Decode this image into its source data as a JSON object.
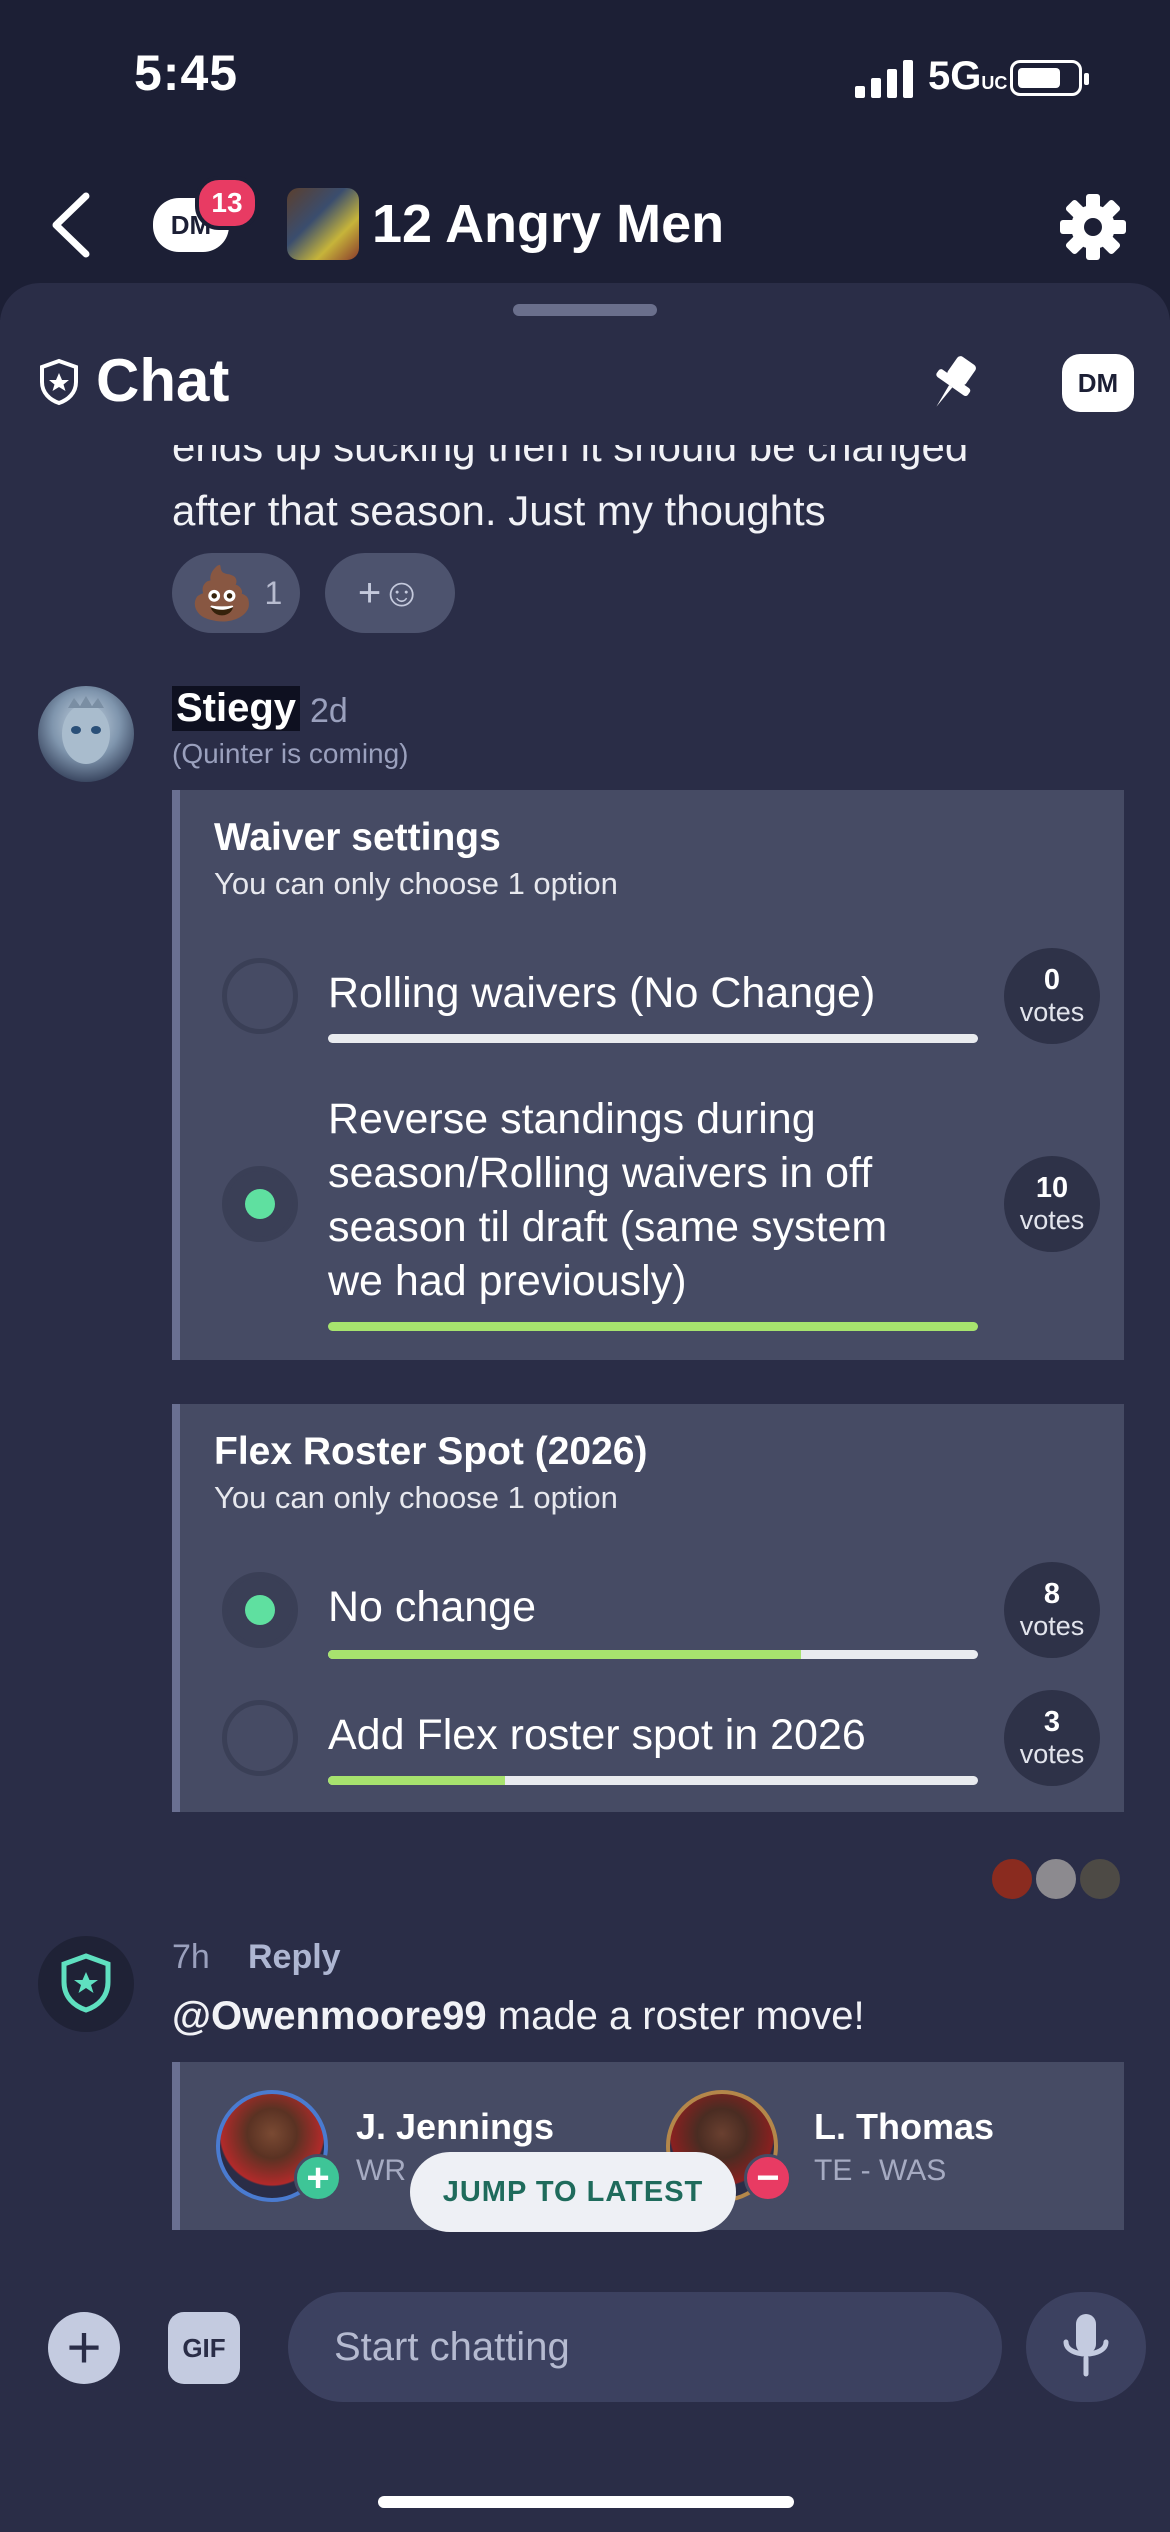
{
  "status_bar": {
    "time": "5:45",
    "network": "5G",
    "network_sup": "UC"
  },
  "header": {
    "dm_label": "DM",
    "dm_count": "13",
    "group_name": "12 Angry Men",
    "icons": [
      "back-chevron-icon",
      "dm-bubble-icon",
      "gear-icon"
    ]
  },
  "chat_header": {
    "title": "Chat",
    "dm_label": "DM",
    "icons": [
      "shield-icon",
      "pin-icon"
    ]
  },
  "previous_message": {
    "line1": "ends up sucking then it should be changed",
    "line2": "after that season. Just my thoughts",
    "reaction_emoji": "💩",
    "reaction_count": "1",
    "add_reaction_label": "+☺"
  },
  "post": {
    "username": "Stiegy",
    "time": "2d",
    "subtitle": "(Quinter is coming)",
    "polls": [
      {
        "title": "Waiver settings",
        "subtitle": "You can only choose 1 option",
        "options": [
          {
            "lines": [
              "Rolling waivers (No Change)"
            ],
            "votes": "0",
            "votes_label": "votes",
            "selected": false,
            "share": 0.0
          },
          {
            "lines": [
              "Reverse standings during",
              "season/Rolling waivers in off",
              "season til draft (same system",
              "we had previously)"
            ],
            "votes": "10",
            "votes_label": "votes",
            "selected": true,
            "share": 1.0
          }
        ]
      },
      {
        "title": "Flex Roster Spot (2026)",
        "subtitle": "You can only choose 1 option",
        "options": [
          {
            "lines": [
              "No change"
            ],
            "votes": "8",
            "votes_label": "votes",
            "selected": true,
            "share": 0.727
          },
          {
            "lines": [
              "Add Flex roster spot in 2026"
            ],
            "votes": "3",
            "votes_label": "votes",
            "selected": false,
            "share": 0.273
          }
        ]
      }
    ]
  },
  "roster_move": {
    "time": "7h",
    "reply_label": "Reply",
    "mention": "@Owenmoore99",
    "text": " made a roster move!",
    "added": {
      "name": "J. Jennings",
      "position": "WR - SF"
    },
    "dropped": {
      "name": "L. Thomas",
      "position": "TE - WAS"
    }
  },
  "jump_button": "JUMP TO LATEST",
  "composer": {
    "placeholder": "Start chatting",
    "gif_label": "GIF",
    "icons": [
      "plus-icon",
      "microphone-icon"
    ]
  },
  "colors": {
    "background": "#1c1f35",
    "panel": "#2a2d47",
    "poll_bg": "#464b64",
    "accent_green": "#a7e36e",
    "radio_green": "#5fe0a0",
    "badge_red": "#e83b63"
  }
}
